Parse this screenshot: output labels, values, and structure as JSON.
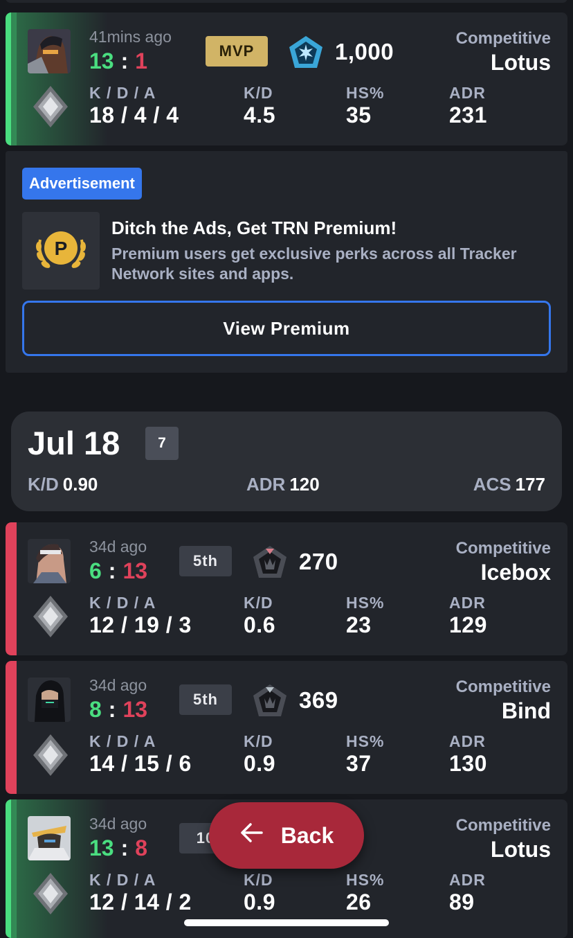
{
  "matches": [
    {
      "ago": "41mins ago",
      "score_us": "13",
      "score_sep": ":",
      "score_them": "1",
      "badge": "MVP",
      "rr": "1,000",
      "mode": "Competitive",
      "map": "Lotus",
      "kda_label": "K / D / A",
      "kda": "18 / 4 / 4",
      "kd_label": "K/D",
      "kd": "4.5",
      "hs_label": "HS%",
      "hs": "35",
      "adr_label": "ADR",
      "adr": "231"
    },
    {
      "ago": "34d ago",
      "score_us": "6",
      "score_sep": ":",
      "score_them": "13",
      "badge": "5th",
      "rr": "270",
      "mode": "Competitive",
      "map": "Icebox",
      "kda_label": "K / D / A",
      "kda": "12 / 19 / 3",
      "kd_label": "K/D",
      "kd": "0.6",
      "hs_label": "HS%",
      "hs": "23",
      "adr_label": "ADR",
      "adr": "129"
    },
    {
      "ago": "34d ago",
      "score_us": "8",
      "score_sep": ":",
      "score_them": "13",
      "badge": "5th",
      "rr": "369",
      "mode": "Competitive",
      "map": "Bind",
      "kda_label": "K / D / A",
      "kda": "14 / 15 / 6",
      "kd_label": "K/D",
      "kd": "0.9",
      "hs_label": "HS%",
      "hs": "37",
      "adr_label": "ADR",
      "adr": "130"
    },
    {
      "ago": "34d ago",
      "score_us": "13",
      "score_sep": ":",
      "score_them": "8",
      "badge": "10",
      "mode": "Competitive",
      "map": "Lotus",
      "kda_label": "K / D / A",
      "kda": "12 / 14 / 2",
      "kd_label": "K/D",
      "kd": "0.9",
      "hs_label": "HS%",
      "hs": "26",
      "adr_label": "ADR",
      "adr": "89"
    }
  ],
  "ad": {
    "tag": "Advertisement",
    "title": "Ditch the Ads, Get TRN Premium!",
    "body": "Premium users get exclusive perks across all Tracker Network sites and apps.",
    "button": "View Premium"
  },
  "day": {
    "date": "Jul 18",
    "count": "7",
    "kd_label": "K/D",
    "kd": "0.90",
    "adr_label": "ADR",
    "adr": "120",
    "acs_label": "ACS",
    "acs": "177"
  },
  "back_button": "Back",
  "colors": {
    "win": "#4ade80",
    "loss": "#e0425b",
    "accent": "#3576ec",
    "back": "#a8283a",
    "mvp": "#d1b466"
  }
}
